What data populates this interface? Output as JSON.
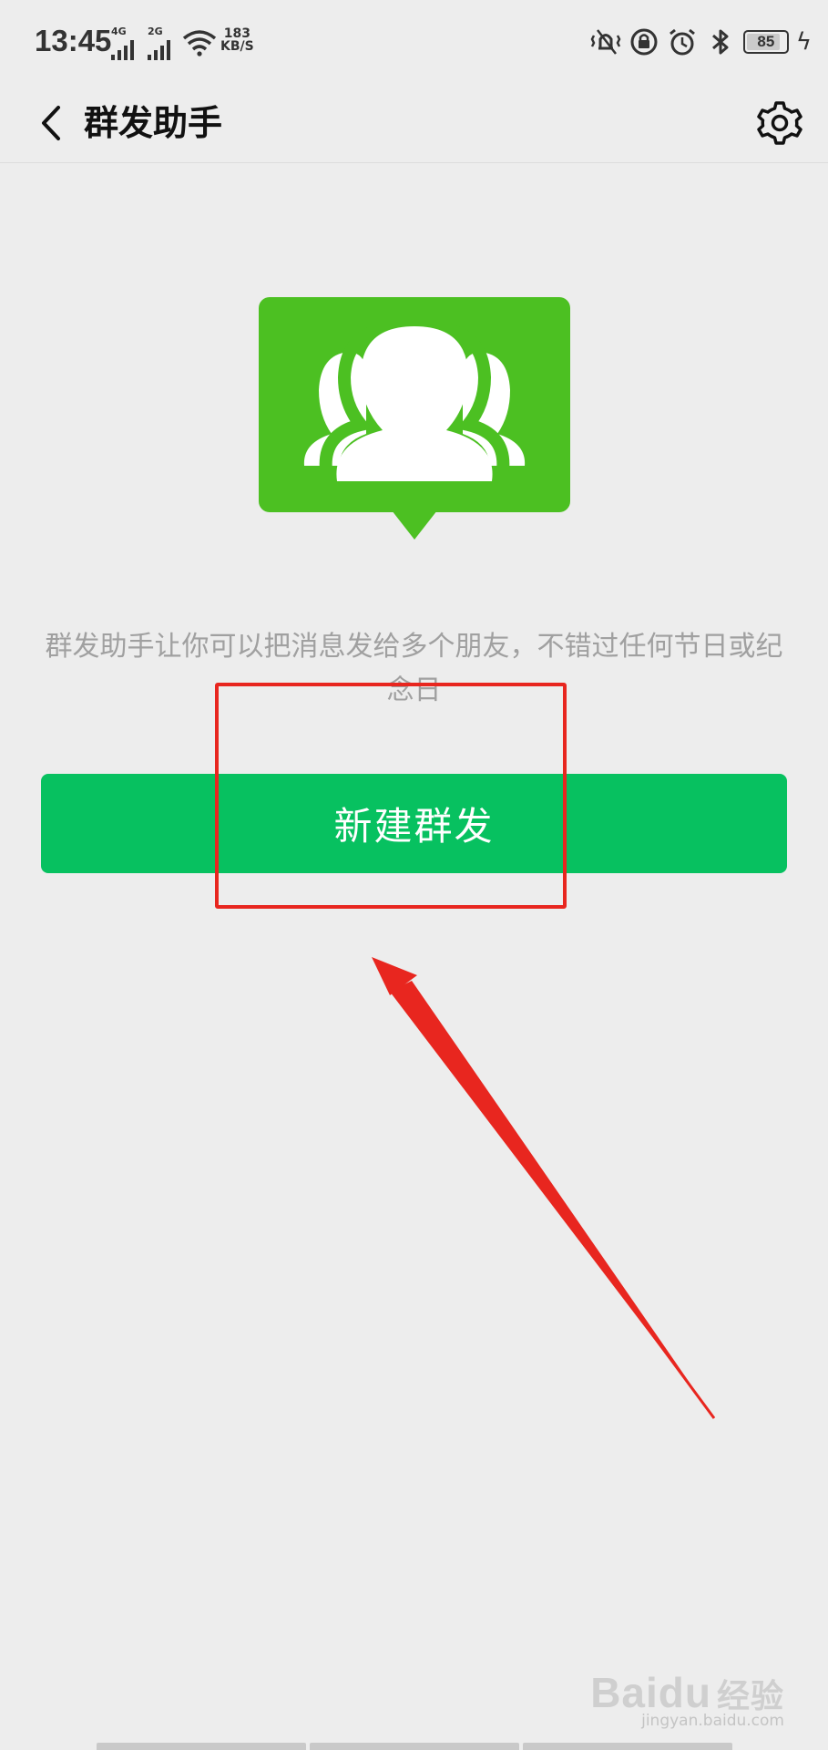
{
  "status_bar": {
    "time": "13:45",
    "signal_1_label": "4G",
    "signal_2_label": "2G",
    "net_speed_value": "183",
    "net_speed_unit": "KB/S",
    "battery_level": "85",
    "battery_fraction": 0.85,
    "icons": [
      "vibrate-icon",
      "lock-rotation-icon",
      "alarm-icon",
      "bluetooth-icon",
      "battery-icon",
      "charging-icon"
    ]
  },
  "nav": {
    "title": "群发助手",
    "back_icon": "chevron-left-icon",
    "settings_icon": "gear-icon"
  },
  "hero": {
    "icon": "group-chat-icon",
    "color": "#4cc022"
  },
  "description": "群发助手让你可以把消息发给多个朋友，不错过任何节日或纪念日",
  "primary_button": {
    "label": "新建群发",
    "color": "#07c160"
  },
  "annotation": {
    "color": "#e8261f"
  },
  "watermark": {
    "logo_text": "Baidu",
    "logo_cn": "经验",
    "url": "jingyan.baidu.com"
  }
}
